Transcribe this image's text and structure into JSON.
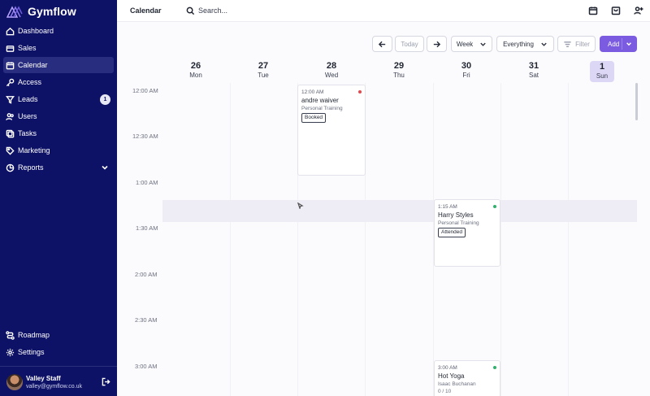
{
  "brand": {
    "name": "Gymflow"
  },
  "sidebar": {
    "items": [
      {
        "label": "Dashboard",
        "icon": "home-icon"
      },
      {
        "label": "Sales",
        "icon": "cash-icon"
      },
      {
        "label": "Calendar",
        "icon": "calendar-icon",
        "active": true
      },
      {
        "label": "Access",
        "icon": "key-icon"
      },
      {
        "label": "Leads",
        "icon": "filter-icon",
        "badge": "1"
      },
      {
        "label": "Users",
        "icon": "users-icon"
      },
      {
        "label": "Tasks",
        "icon": "tasks-icon"
      },
      {
        "label": "Marketing",
        "icon": "tag-icon"
      },
      {
        "label": "Reports",
        "icon": "chart-icon",
        "expandable": true
      }
    ],
    "bottom": [
      {
        "label": "Roadmap",
        "icon": "roadmap-icon"
      },
      {
        "label": "Settings",
        "icon": "gear-icon"
      }
    ],
    "user": {
      "name": "Valley Staff",
      "email": "valley@gymflow.co.uk"
    }
  },
  "topbar": {
    "title": "Calendar",
    "search_placeholder": "Search..."
  },
  "toolbar": {
    "today": "Today",
    "view": "Week",
    "scope": "Everything",
    "filter": "Filter",
    "add": "Add"
  },
  "days": [
    {
      "num": "26",
      "name": "Mon"
    },
    {
      "num": "27",
      "name": "Tue"
    },
    {
      "num": "28",
      "name": "Wed"
    },
    {
      "num": "29",
      "name": "Thu"
    },
    {
      "num": "30",
      "name": "Fri"
    },
    {
      "num": "31",
      "name": "Sat"
    },
    {
      "num": "1",
      "name": "Sun",
      "today": true
    }
  ],
  "times": [
    "12:00 AM",
    "12:30 AM",
    "1:00 AM",
    "1:30 AM",
    "2:00 AM",
    "2:30 AM",
    "3:00 AM"
  ],
  "events": [
    {
      "time": "12:00 AM",
      "title": "andre waiver",
      "type": "Personal Training",
      "badge": "Booked",
      "dot_color": "#e5484d"
    },
    {
      "time": "1:15 AM",
      "title": "Harry Styles",
      "type": "Personal Training",
      "badge": "Attended",
      "dot_color": "#2fb36b"
    },
    {
      "time": "3:00 AM",
      "title": "Hot Yoga",
      "type": "Isaac Buchanan",
      "badge": "0 / 10",
      "dot_color": "#2fb36b"
    }
  ],
  "colors": {
    "sidebar": "#0e1266",
    "accent": "#7b5ce0",
    "today_highlight": "#dcd7f5"
  }
}
